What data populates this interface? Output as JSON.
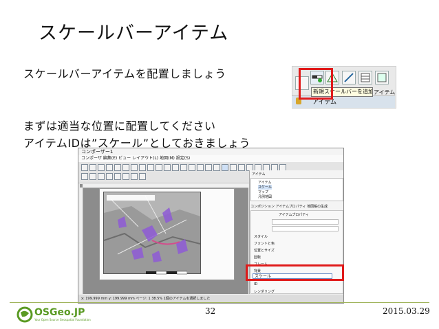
{
  "slide": {
    "title": "スケールバーアイテム",
    "lines": [
      "スケールバーアイテムを配置しましょう",
      "まずは適当な位置に配置してください",
      "アイテムIDは”スケール”としておきましょう"
    ],
    "page_number": "32",
    "date": "2015.03.29"
  },
  "toolbar_crop": {
    "tooltip": "新規スケールバーを追加",
    "tab_label": "アイテム",
    "item_label": "アイテム"
  },
  "composer": {
    "window_title": "コンポーザー1",
    "menu": "コンポーザ 編集(E) ビュー レイアウト(L) 地図(M) 設定(S)",
    "panel_title": "アイテム",
    "list_items": [
      "アイテム",
      "スケール",
      "マップ",
      "凡例地図"
    ],
    "tabs": "コンポジション アイテムプロパティ 地図帳の生成",
    "section_header": "アイテムプロパティ",
    "rows": [
      "スタイル",
      "フォントと色",
      "位置とサイズ",
      "回転",
      "フレーム",
      "背景",
      "アイテムID",
      "レンダリング"
    ],
    "item_id_label": "ID",
    "item_id_value": "スケール",
    "status": "x: 199.999 mm  y: 199.999 mm  ページ: 1  38.5%  1個のアイテムを選択しました"
  },
  "logo": {
    "brand": "OSGeo.JP",
    "tagline": "Your Open Source Geospatial Foundation"
  },
  "colors": {
    "highlight": "#e01a1a",
    "footer_line": "#9fb45a",
    "logo_green": "#5a9a23"
  }
}
